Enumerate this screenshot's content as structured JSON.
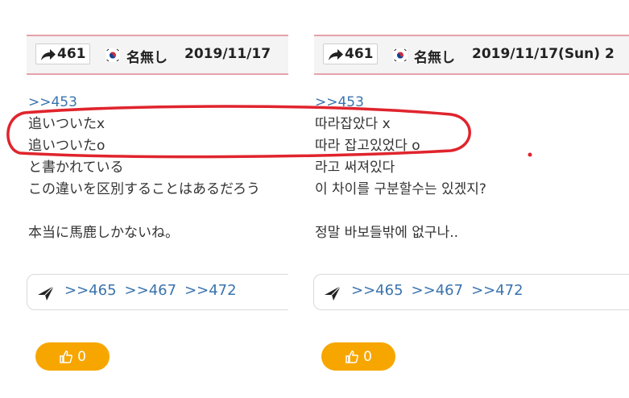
{
  "left": {
    "post_number": "461",
    "name": "名無し",
    "date": "2019/11/17",
    "lines": [
      {
        "text": ">>453",
        "type": "link"
      },
      {
        "text": "追いついたx",
        "type": "text"
      },
      {
        "text": "追いついたo",
        "type": "text"
      },
      {
        "text": "と書かれている",
        "type": "text"
      },
      {
        "text": "この違いを区別することはあるだろう",
        "type": "text"
      },
      {
        "text": "",
        "type": "gap"
      },
      {
        "text": "本当に馬鹿しかないね。",
        "type": "text"
      }
    ],
    "replies": [
      ">>465",
      ">>467",
      ">>472"
    ],
    "likes": "0"
  },
  "right": {
    "post_number": "461",
    "name": "名無し",
    "date": "2019/11/17(Sun) 2",
    "lines": [
      {
        "text": ">>453",
        "type": "link"
      },
      {
        "text": "따라잡았다 x",
        "type": "text"
      },
      {
        "text": "따라 잡고있었다 o",
        "type": "text"
      },
      {
        "text": "라고 써져있다",
        "type": "text"
      },
      {
        "text": "이 차이를 구분할수는 있겠지?",
        "type": "text"
      },
      {
        "text": "",
        "type": "gap"
      },
      {
        "text": "정말 바보들밖에 없구나..",
        "type": "text"
      }
    ],
    "replies": [
      ">>465",
      ">>467",
      ">>472"
    ],
    "likes": "0"
  },
  "icons": {
    "share": "share-arrow-icon",
    "flag": "korea-flag-icon",
    "reply": "paper-plane-icon",
    "like": "thumbs-up-icon"
  },
  "colors": {
    "header_border": "#e6a1ab",
    "link": "#3a73ad",
    "like_button": "#f7a600",
    "highlight": "#e0242d"
  }
}
